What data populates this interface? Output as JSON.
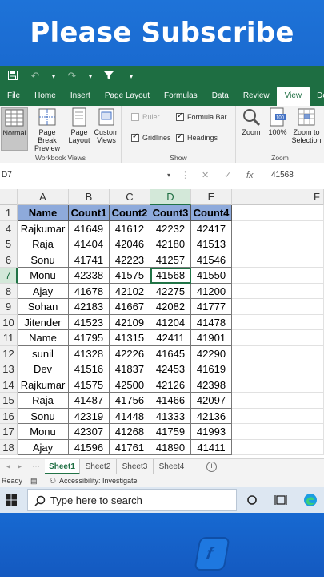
{
  "banner": {
    "text": "Please Subscribe"
  },
  "ribbon_tabs": [
    "File",
    "Home",
    "Insert",
    "Page Layout",
    "Formulas",
    "Data",
    "Review",
    "View",
    "Dev"
  ],
  "active_tab": "View",
  "workbook_views": {
    "normal": "Normal",
    "page_break_1": "Page Break",
    "page_break_2": "Preview",
    "page_layout_1": "Page",
    "page_layout_2": "Layout",
    "custom_1": "Custom",
    "custom_2": "Views",
    "label": "Workbook Views"
  },
  "show": {
    "ruler": "Ruler",
    "formula_bar": "Formula Bar",
    "gridlines": "Gridlines",
    "headings": "Headings",
    "label": "Show"
  },
  "zoom": {
    "zoom": "Zoom",
    "hundred": "100%",
    "zoom_sel_1": "Zoom to",
    "zoom_sel_2": "Selection",
    "label": "Zoom"
  },
  "formula_bar": {
    "name_box": "D7",
    "fx": "fx",
    "value": "41568"
  },
  "columns": [
    "A",
    "B",
    "C",
    "D",
    "E",
    "F"
  ],
  "table": {
    "headers": [
      "Name",
      "Count1",
      "Count2",
      "Count3",
      "Count4"
    ],
    "rows": [
      {
        "row": "4",
        "cells": [
          "Rajkumar",
          "41649",
          "41612",
          "42232",
          "42417"
        ]
      },
      {
        "row": "5",
        "cells": [
          "Raja",
          "41404",
          "42046",
          "42180",
          "41513"
        ]
      },
      {
        "row": "6",
        "cells": [
          "Sonu",
          "41741",
          "42223",
          "41257",
          "41546"
        ]
      },
      {
        "row": "7",
        "cells": [
          "Monu",
          "42338",
          "41575",
          "41568",
          "41550"
        ]
      },
      {
        "row": "8",
        "cells": [
          "Ajay",
          "41678",
          "42102",
          "42275",
          "41200"
        ]
      },
      {
        "row": "9",
        "cells": [
          "Sohan",
          "42183",
          "41667",
          "42082",
          "41777"
        ]
      },
      {
        "row": "10",
        "cells": [
          "Jitender",
          "41523",
          "42109",
          "41204",
          "41478"
        ]
      },
      {
        "row": "11",
        "cells": [
          "Name",
          "41795",
          "41315",
          "42411",
          "41901"
        ]
      },
      {
        "row": "12",
        "cells": [
          "sunil",
          "41328",
          "42226",
          "41645",
          "42290"
        ]
      },
      {
        "row": "13",
        "cells": [
          "Dev",
          "41516",
          "41837",
          "42453",
          "41619"
        ]
      },
      {
        "row": "14",
        "cells": [
          "Rajkumar",
          "41575",
          "42500",
          "42126",
          "42398"
        ]
      },
      {
        "row": "15",
        "cells": [
          "Raja",
          "41487",
          "41756",
          "41466",
          "42097"
        ]
      },
      {
        "row": "16",
        "cells": [
          "Sonu",
          "42319",
          "41448",
          "41333",
          "42136"
        ]
      },
      {
        "row": "17",
        "cells": [
          "Monu",
          "42307",
          "41268",
          "41759",
          "41993"
        ]
      },
      {
        "row": "18",
        "cells": [
          "Ajay",
          "41596",
          "41761",
          "41890",
          "41411"
        ]
      }
    ]
  },
  "header_row_number": "1",
  "sheets": [
    "Sheet1",
    "Sheet2",
    "Sheet3",
    "Sheet4"
  ],
  "status": {
    "ready": "Ready",
    "accessibility": "Accessibility: Investigate"
  },
  "taskbar": {
    "search_placeholder": "Type here to search"
  },
  "colors": {
    "excel_green": "#217346",
    "header_fill": "#8eaadb",
    "banner_blue": "#1a6ad0"
  }
}
